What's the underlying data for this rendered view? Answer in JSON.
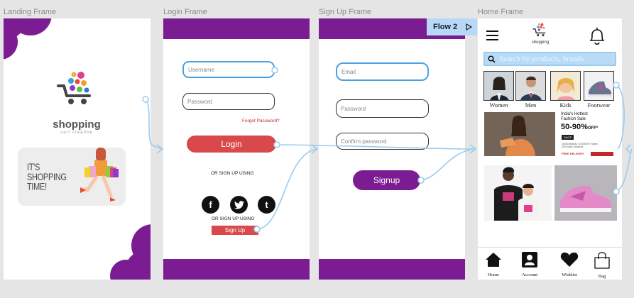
{
  "frames": {
    "landing": "Landing Frame",
    "login": "Login Frame",
    "signup": "Sign Up Frame",
    "home": "Home Frame"
  },
  "landing": {
    "logo_title": "shopping",
    "logo_sub": "cart creative",
    "promo_text": "IT'S\nSHOPPING\nTIME!"
  },
  "login": {
    "username_placeholder": "Username",
    "password_placeholder": "Password",
    "forgot": "Forgot Password?",
    "login_button": "Login",
    "or_sign_up_using": "OR SIGN UP USING",
    "or_sign_up_using_2": "OR SIGN UP USING",
    "sign_up_button": "Sign Up",
    "social": [
      "f",
      "t"
    ]
  },
  "signup": {
    "email_placeholder": "Email",
    "password_placeholder": "Password",
    "confirm_placeholder": "Confirm password",
    "signup_button": "Signup"
  },
  "flow": {
    "label": "Flow 2"
  },
  "home": {
    "logo_text": "shopping",
    "search_placeholder": "Search by products, brands",
    "categories": [
      "Women",
      "Men",
      "Kids",
      "Footwear"
    ],
    "banner": {
      "line1": "India's Hottest\nFashion Sale",
      "discount": "50-90%",
      "off": "OFF*",
      "shop": "SHOP",
      "small": "10000 Brands | 1000000+ Styles\n20% Style Discount",
      "free": "FREE DELIVERY"
    },
    "nav": [
      "Home",
      "Account",
      "Wishlist",
      "Bag"
    ]
  },
  "colors": {
    "brand_purple": "#7b1c93",
    "accent_red": "#d9494b",
    "flow_blue": "#9ccbef",
    "canvas": "#e5e5e5"
  }
}
